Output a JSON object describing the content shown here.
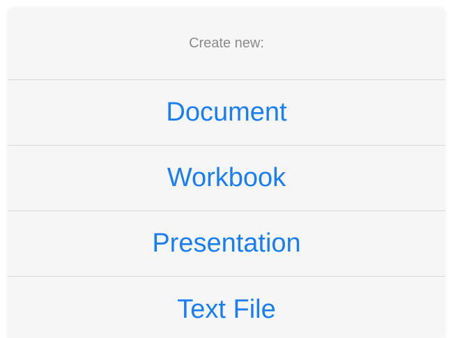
{
  "sheet": {
    "title": "Create new:",
    "actions": [
      {
        "label": "Document"
      },
      {
        "label": "Workbook"
      },
      {
        "label": "Presentation"
      },
      {
        "label": "Text File"
      }
    ]
  },
  "colors": {
    "accent": "#1a7ef2",
    "title_text": "#8a8a8a",
    "background": "#f6f6f6",
    "separator": "#d6d6d6"
  }
}
